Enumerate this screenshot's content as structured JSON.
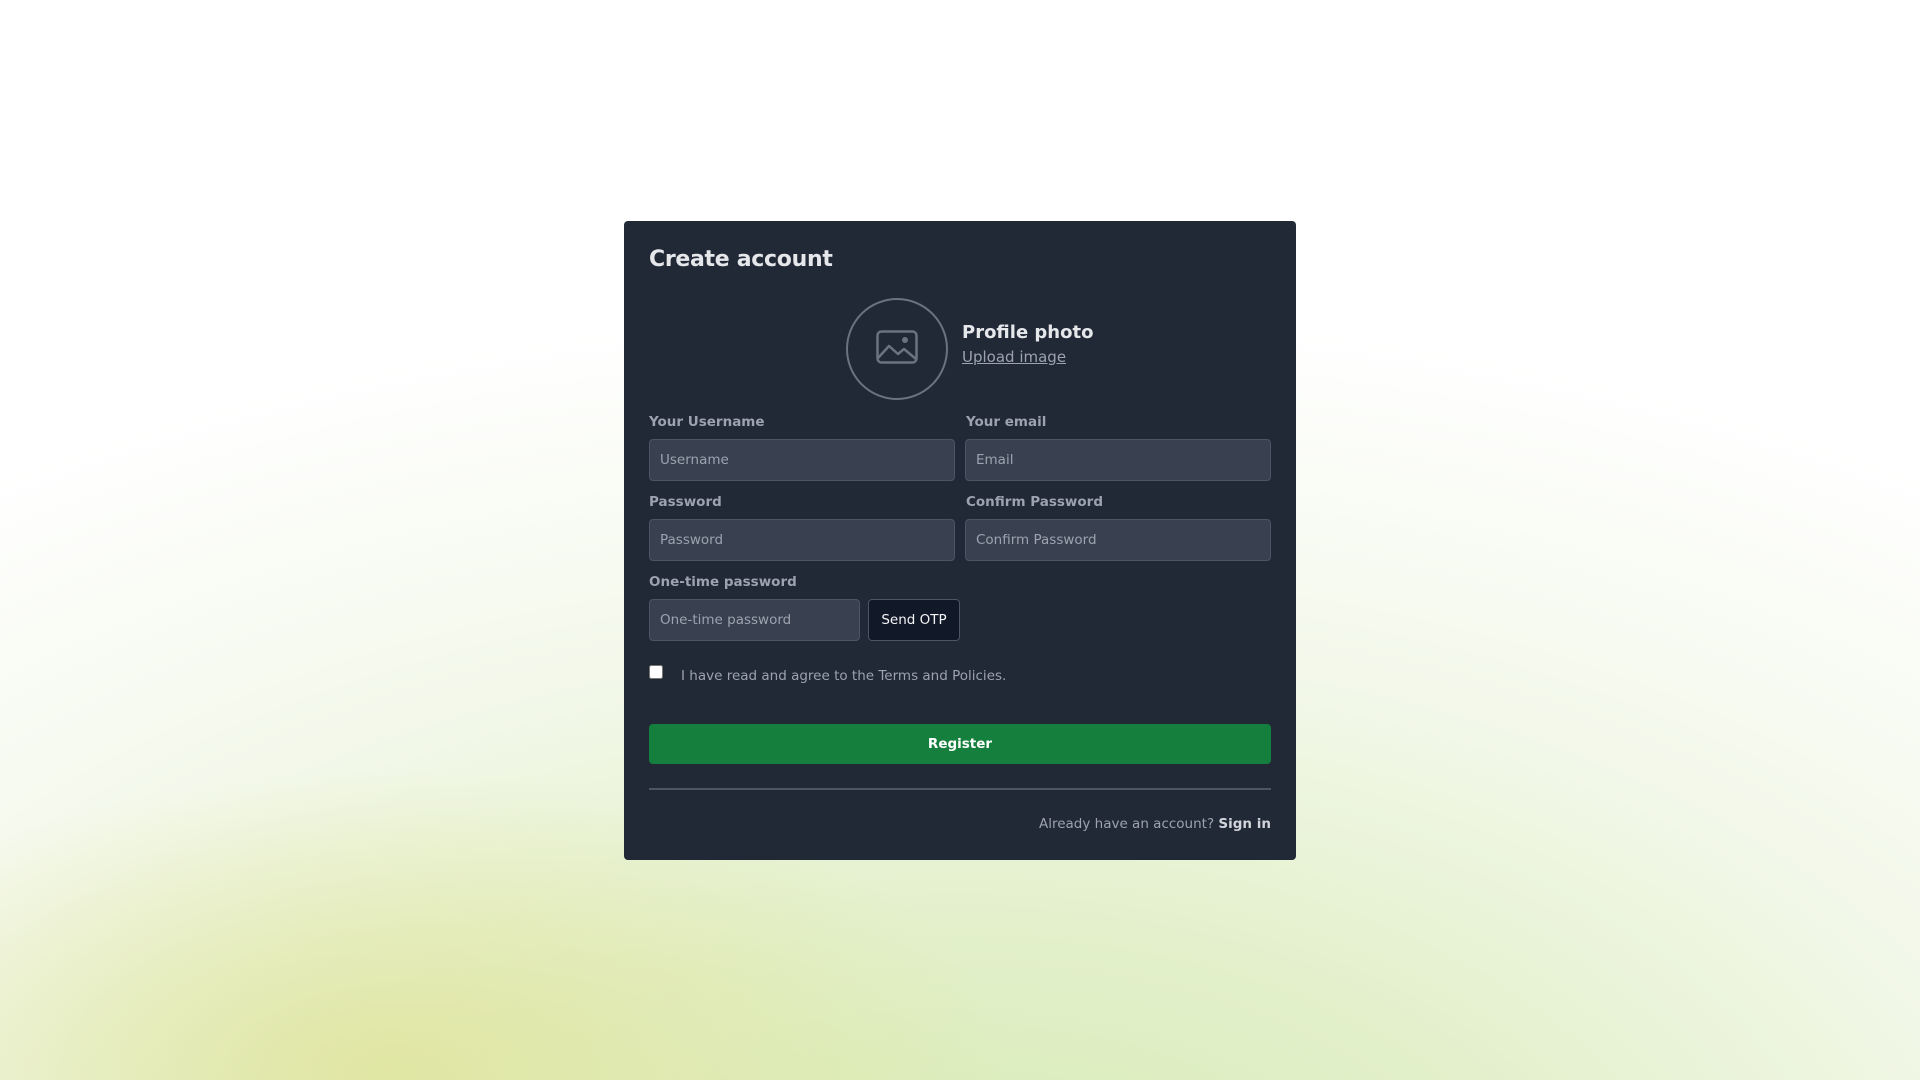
{
  "form": {
    "title": "Create account",
    "profile": {
      "label": "Profile photo",
      "upload_label": "Upload image",
      "icon": "image-icon"
    },
    "username": {
      "label": "Your Username",
      "placeholder": "Username",
      "value": ""
    },
    "email": {
      "label": "Your email",
      "placeholder": "Email",
      "value": ""
    },
    "password": {
      "label": "Password",
      "placeholder": "Password",
      "value": ""
    },
    "confirm_password": {
      "label": "Confirm Password",
      "placeholder": "Confirm Password",
      "value": ""
    },
    "otp": {
      "label": "One-time password",
      "placeholder": "One-time password",
      "value": "",
      "button_label": "Send OTP"
    },
    "terms": {
      "label": "I have read and agree to the Terms and Policies.",
      "checked": false
    },
    "register_label": "Register",
    "footer": {
      "text": "Already have an account?",
      "signin_label": "Sign in"
    }
  },
  "colors": {
    "card_background": "#212836",
    "input_background": "#394150",
    "accent_green": "#15803d"
  }
}
